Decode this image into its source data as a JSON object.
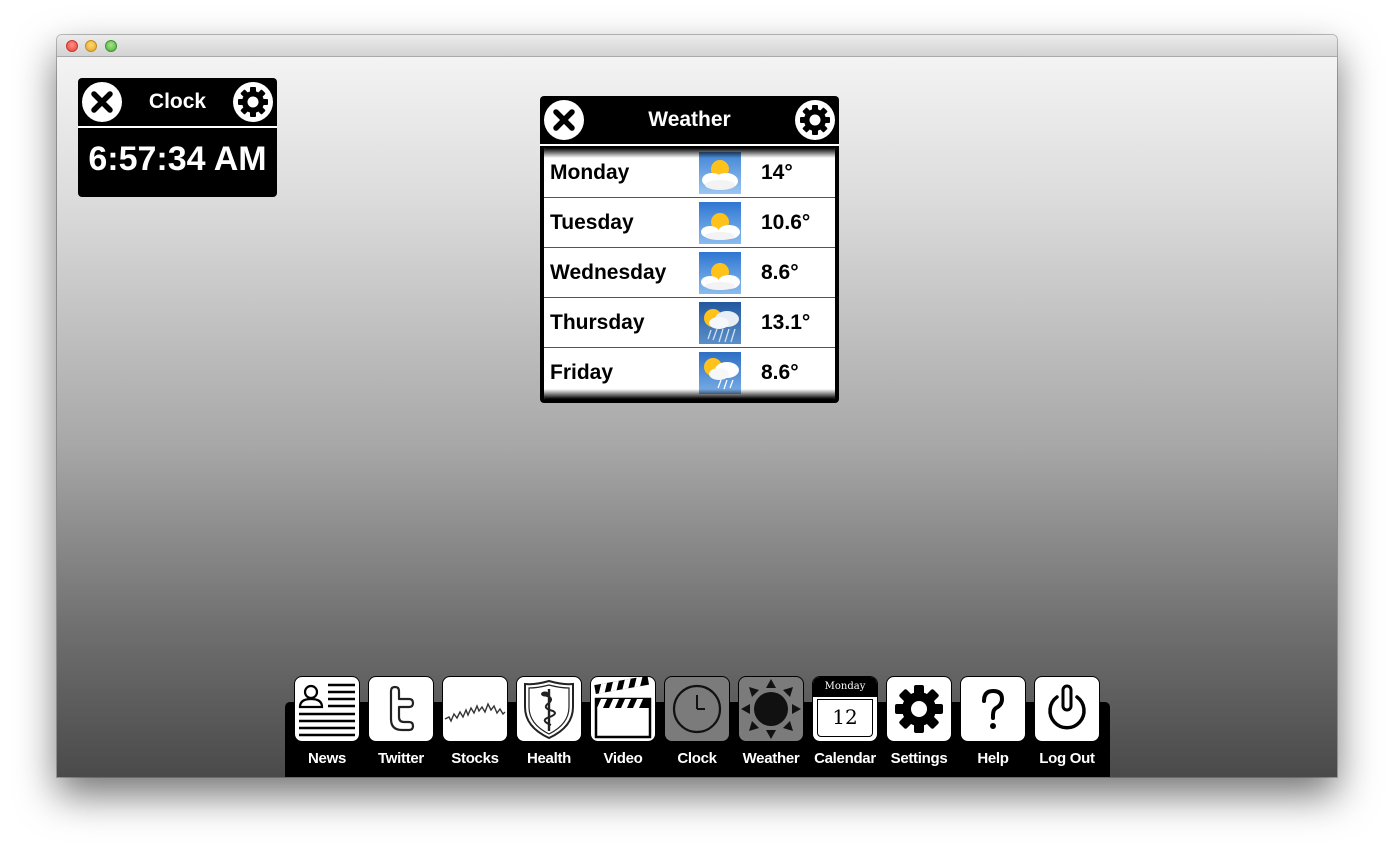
{
  "window": {
    "controls": [
      "close",
      "minimize",
      "zoom"
    ]
  },
  "clock_widget": {
    "title": "Clock",
    "time": "6:57:34 AM",
    "close_icon": "close-icon",
    "settings_icon": "gear-icon"
  },
  "weather_widget": {
    "title": "Weather",
    "close_icon": "close-icon",
    "settings_icon": "gear-icon",
    "forecast": [
      {
        "day": "Monday",
        "temp": "14°",
        "icon": "partly-cloudy-icon"
      },
      {
        "day": "Tuesday",
        "temp": "10.6°",
        "icon": "partly-cloudy-icon"
      },
      {
        "day": "Wednesday",
        "temp": "8.6°",
        "icon": "partly-cloudy-icon"
      },
      {
        "day": "Thursday",
        "temp": "13.1°",
        "icon": "rain-icon"
      },
      {
        "day": "Friday",
        "temp": "8.6°",
        "icon": "rain-icon"
      }
    ]
  },
  "dock": {
    "items": [
      {
        "label": "News",
        "icon": "newspaper-icon"
      },
      {
        "label": "Twitter",
        "icon": "twitter-icon"
      },
      {
        "label": "Stocks",
        "icon": "stock-chart-icon"
      },
      {
        "label": "Health",
        "icon": "caduceus-icon"
      },
      {
        "label": "Video",
        "icon": "clapperboard-icon"
      },
      {
        "label": "Clock",
        "icon": "clock-icon"
      },
      {
        "label": "Weather",
        "icon": "sun-icon"
      },
      {
        "label": "Calendar",
        "icon": "calendar-icon",
        "calendar_weekday": "Monday",
        "calendar_date": "12"
      },
      {
        "label": "Settings",
        "icon": "gear-icon"
      },
      {
        "label": "Help",
        "icon": "question-icon"
      },
      {
        "label": "Log Out",
        "icon": "power-icon"
      }
    ]
  },
  "colors": {
    "widget_background": "#000000",
    "dock_background": "#000000",
    "active_dock_tile": "#7b7b7b"
  }
}
